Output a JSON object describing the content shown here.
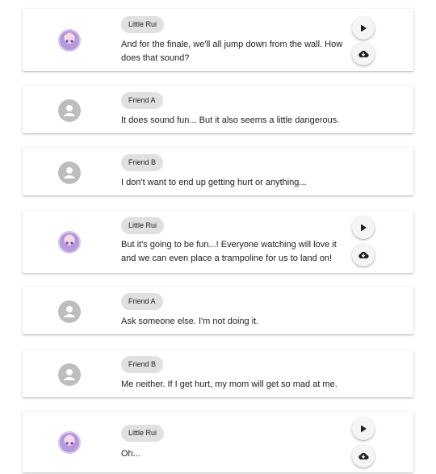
{
  "messages": [
    {
      "speaker": "Little Rui",
      "avatar_icon": "character-portrait-icon",
      "text": "And for the finale, we'll all jump down from the wall. How does that sound?",
      "has_audio": true
    },
    {
      "speaker": "Friend A",
      "avatar_icon": "person-icon",
      "text": "It does sound fun... But it also seems a little dangerous.",
      "has_audio": false
    },
    {
      "speaker": "Friend B",
      "avatar_icon": "person-icon",
      "text": "I don't want to end up getting hurt or anything...",
      "has_audio": false
    },
    {
      "speaker": "Little Rui",
      "avatar_icon": "character-portrait-icon",
      "text": "But it's going to be fun...! Everyone watching will love it and we can even place a trampoline for us to land on!",
      "has_audio": true
    },
    {
      "speaker": "Friend A",
      "avatar_icon": "person-icon",
      "text": "Ask someone else. I'm not doing it.",
      "has_audio": false
    },
    {
      "speaker": "Friend B",
      "avatar_icon": "person-icon",
      "text": "Me neither. If I get hurt, my mom will get so mad at me.",
      "has_audio": false
    },
    {
      "speaker": "Little Rui",
      "avatar_icon": "character-portrait-icon",
      "text": "Oh...",
      "has_audio": true
    }
  ],
  "action_icons": {
    "play": "play-icon",
    "download": "cloud-download-icon"
  },
  "colors": {
    "chip_bg": "#e0e0e0",
    "generic_avatar": "#bdbdbd",
    "button_bg": "#f5f5f5"
  }
}
